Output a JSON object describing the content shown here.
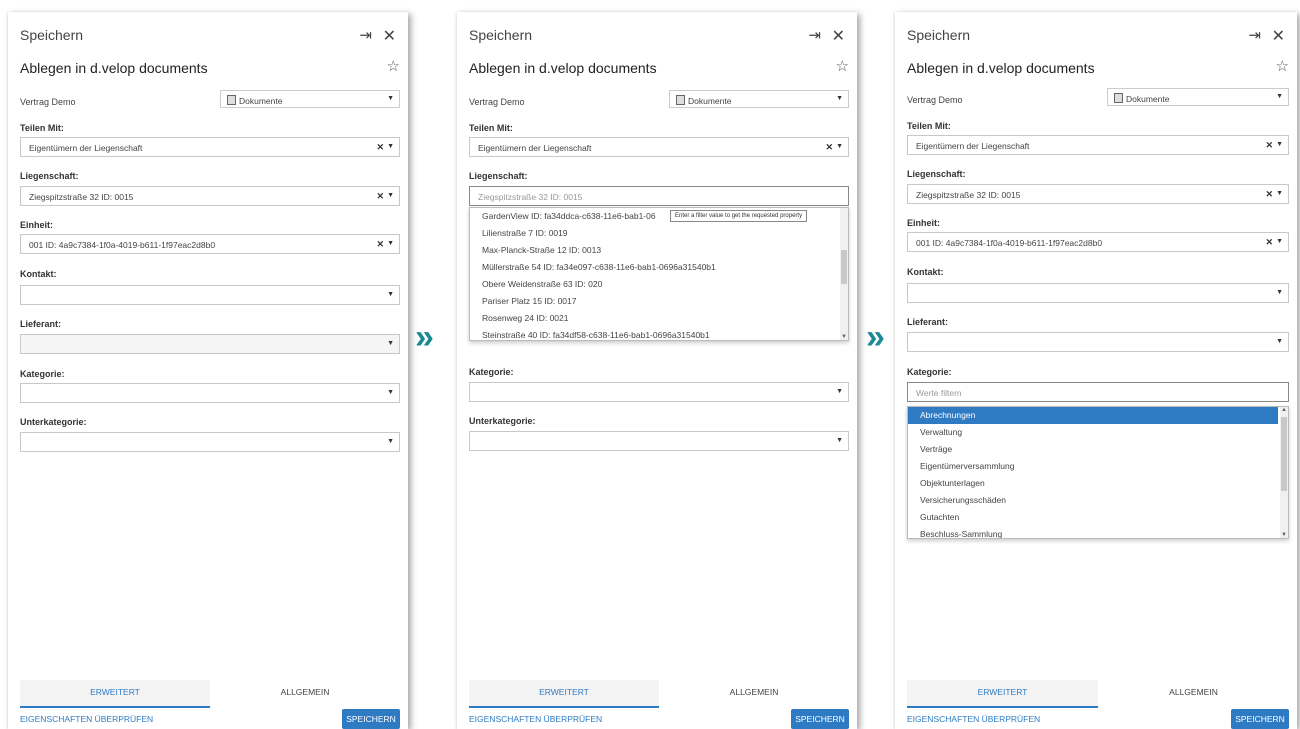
{
  "header": {
    "title": "Speichern",
    "subtitle": "Ablegen in d.velop documents"
  },
  "form": {
    "vertrag_label": "Vertrag Demo",
    "storage_value": "Dokumente",
    "teilen_label": "Teilen Mit:",
    "teilen_value": "Eigentümern der Liegenschaft",
    "liegenschaft_label": "Liegenschaft:",
    "liegenschaft_value": "Ziegspitzstraße 32 ID: 0015",
    "einheit_label": "Einheit:",
    "einheit_value": "001 ID: 4a9c7384-1f0a-4019-b611-1f97eac2d8b0",
    "kontakt_label": "Kontakt:",
    "lieferant_label": "Lieferant:",
    "kategorie_label": "Kategorie:",
    "unterkategorie_label": "Unterkategorie:",
    "filter_placeholder": "Werte filtern"
  },
  "liegenschaft_list": [
    "GardenView ID: fa34ddca-c638-11e6-bab1-06",
    "Lilienstraße 7 ID: 0019",
    "Max-Planck-Straße 12 ID: 0013",
    "Müllerstraße 54 ID: fa34e097-c638-11e6-bab1-0696a31540b1",
    "Obere Weidenstraße 63 ID: 020",
    "Pariser Platz 15 ID: 0017",
    "Rosenweg 24 ID: 0021",
    "Steinstraße 40 ID: fa34df58-c638-11e6-bab1-0696a31540b1"
  ],
  "tooltip": "Enter a filter value to get the requested property",
  "kategorie_list": [
    "Abrechnungen",
    "Verwaltung",
    "Verträge",
    "Eigentümerversammlung",
    "Objektunterlagen",
    "Versicherungsschäden",
    "Gutachten",
    "Beschluss-Sammlung"
  ],
  "footer": {
    "tab_erweitert": "ERWEITERT",
    "tab_allgemein": "ALLGEMEIN",
    "check_label": "EIGENSCHAFTEN ÜBERPRÜFEN",
    "save_label": "SPEICHERN"
  },
  "arrow_glyph": "»",
  "colors": {
    "accent": "#2e7bc4",
    "arrow": "#1a8a94"
  }
}
